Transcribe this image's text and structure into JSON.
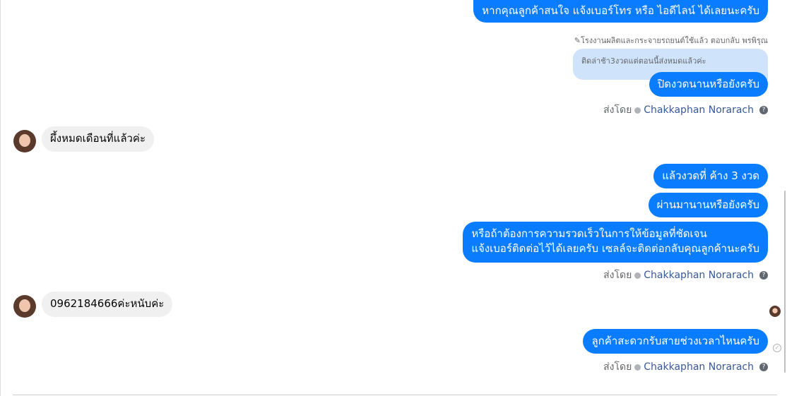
{
  "conversation": {
    "messages": [
      {
        "text": "หากคุณลูกค้าสนใจ แจ้งเบอร์โทร หรือ ไอดีไลน์ ได้เลยนะครับ"
      },
      {
        "reply_meta": "โรงงานผลิตและกระจายรถยนต์ใช้แล้ว ตอบกลับ พรพิรุณ",
        "quoted": "ติดล่าช้า3งวดแต่ตอนนี้ส่งหมดแล้วค่ะ",
        "text": "ปิดงวดนานหรือยังครับ"
      },
      {
        "text": "ผึ้งหมดเดือนที่แล้วค่ะ"
      },
      {
        "text": "แล้วงวดที่ ค้าง 3 งวด"
      },
      {
        "text": "ผ่านมานานหรือยังครับ"
      },
      {
        "text_line1": "หรือถ้าต้องการความรวดเร็วในการให้ข้อมูลที่ชัดเจน",
        "text_line2": "แจ้งเบอร์ติดต่อไว้ได้เลยครับ เซลล์จะติดต่อกลับคุณลูกค้านะครับ"
      },
      {
        "text": "0962184666ค่ะหนับค่ะ"
      },
      {
        "text": "ลูกค้าสะดวกรับสายช่วงเวลาไหนครับ"
      }
    ],
    "sent_by": {
      "label": "ส่งโดย",
      "name": "Chakkaphan Norarach",
      "help": "?"
    }
  },
  "icons": [
    "verified-icon",
    "help-icon",
    "avatar",
    "seen-avatar",
    "sent-check-icon"
  ],
  "colors": {
    "outgoing_bubble": "#0a7cff",
    "incoming_bubble": "#f0f0f0",
    "quoted_bubble": "#cfe3fb",
    "sender_name": "#385898"
  }
}
